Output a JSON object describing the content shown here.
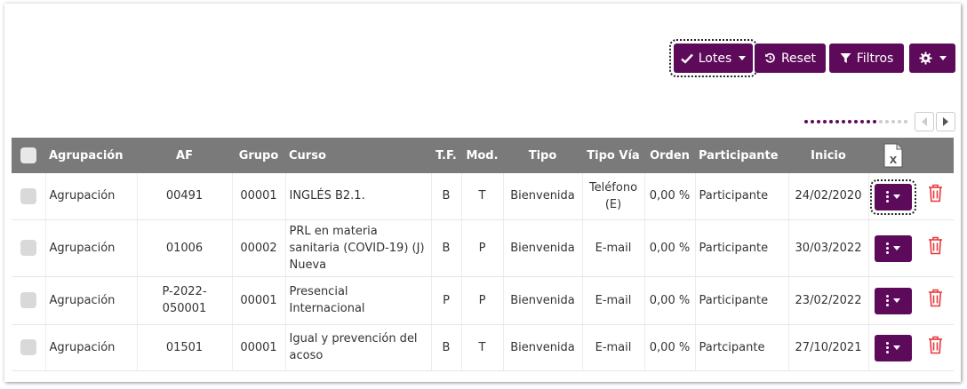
{
  "toolbar": {
    "lotes_label": "Lotes",
    "reset_label": "Reset",
    "filtros_label": "Filtros"
  },
  "pager": {
    "dots_total": 17,
    "dots_active": 12
  },
  "colors": {
    "primary": "#5e0a5a",
    "header_bg": "#7a7a7a",
    "danger": "#e8393f"
  },
  "table": {
    "headers": {
      "agrupacion": "Agrupación",
      "af": "AF",
      "grupo": "Grupo",
      "curso": "Curso",
      "tf": "T.F.",
      "mod": "Mod.",
      "tipo": "Tipo",
      "tipo_via": "Tipo Vía",
      "orden": "Orden",
      "participante": "Participante",
      "inicio": "Inicio"
    },
    "rows": [
      {
        "agrupacion": "Agrupación",
        "af": "00491",
        "grupo": "00001",
        "curso": "INGLÉS B2.1.",
        "tf": "B",
        "mod": "T",
        "tipo": "Bienvenida",
        "tipo_via": "Teléfono (E)",
        "orden": "0,00 %",
        "participante": "Participante",
        "inicio": "24/02/2020"
      },
      {
        "agrupacion": "Agrupación",
        "af": "01006",
        "grupo": "00002",
        "curso": "PRL en materia sanitaria (COVID-19) (J) Nueva",
        "tf": "B",
        "mod": "P",
        "tipo": "Bienvenida",
        "tipo_via": "E-mail",
        "orden": "0,00 %",
        "participante": "Participante",
        "inicio": "30/03/2022"
      },
      {
        "agrupacion": "Agrupación",
        "af": "P-2022-050001",
        "grupo": "00001",
        "curso": "Presencial Internacional",
        "tf": "P",
        "mod": "P",
        "tipo": "Bienvenida",
        "tipo_via": "E-mail",
        "orden": "0,00 %",
        "participante": "Participante",
        "inicio": "23/02/2022"
      },
      {
        "agrupacion": "Agrupación",
        "af": "01501",
        "grupo": "00001",
        "curso": "Igual y prevención del acoso",
        "tf": "B",
        "mod": "T",
        "tipo": "Bienvenida",
        "tipo_via": "E-mail",
        "orden": "0,00 %",
        "participante": "Partcipante",
        "inicio": "27/10/2021"
      }
    ]
  }
}
